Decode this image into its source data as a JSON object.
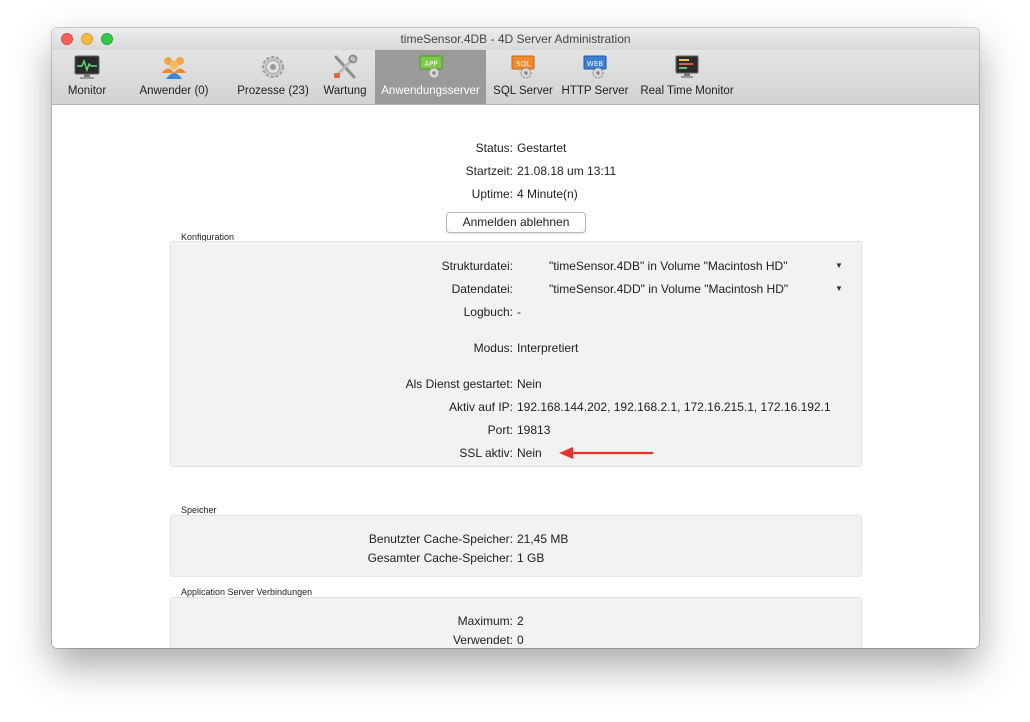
{
  "window": {
    "title": "timeSensor.4DB - 4D Server Administration"
  },
  "toolbar": {
    "items": [
      {
        "label": "Monitor",
        "icon": "monitor-icon"
      },
      {
        "label": "Anwender (0)",
        "icon": "users-icon"
      },
      {
        "label": "Prozesse (23)",
        "icon": "gear-icon"
      },
      {
        "label": "Wartung",
        "icon": "tools-icon"
      },
      {
        "label": "Anwendungsserver",
        "icon": "app-server-icon",
        "active": true
      },
      {
        "label": "SQL Server",
        "icon": "sql-server-icon"
      },
      {
        "label": "HTTP Server",
        "icon": "web-server-icon"
      },
      {
        "label": "Real Time Monitor",
        "icon": "realtime-monitor-icon"
      }
    ],
    "icon_badges": {
      "app": "APP",
      "sql": "SQL",
      "web": "WEB"
    }
  },
  "status": {
    "status_label": "Status:",
    "status_value": "Gestartet",
    "start_label": "Startzeit:",
    "start_value": "21.08.18 um 13:11",
    "uptime_label": "Uptime:",
    "uptime_value": "4 Minute(n)"
  },
  "reject_button": "Anmelden ablehnen",
  "config": {
    "title": "Konfiguration",
    "struktur_label": "Strukturdatei:",
    "struktur_value": "\"timeSensor.4DB\" in Volume \"Macintosh HD\"",
    "daten_label": "Datendatei:",
    "daten_value": "\"timeSensor.4DD\" in Volume \"Macintosh HD\"",
    "log_label": "Logbuch:",
    "log_value": "-",
    "modus_label": "Modus:",
    "modus_value": "Interpretiert",
    "dienst_label": "Als Dienst gestartet:",
    "dienst_value": "Nein",
    "ip_label": "Aktiv auf IP:",
    "ip_value": "192.168.144.202, 192.168.2.1, 172.16.215.1, 172.16.192.1",
    "port_label": "Port:",
    "port_value": "19813",
    "ssl_label": "SSL aktiv:",
    "ssl_value": "Nein"
  },
  "memory": {
    "title": "Speicher",
    "used_label": "Benutzter Cache-Speicher:",
    "used_value": "21,45 MB",
    "total_label": "Gesamter Cache-Speicher:",
    "total_value": "1 GB"
  },
  "connections": {
    "title": "Application Server Verbindungen",
    "max_label": "Maximum:",
    "max_value": "2",
    "used_label": "Verwendet:",
    "used_value": "0"
  },
  "colors": {
    "accent_arrow": "#e8322a",
    "active_tab": "#9a9a9a"
  }
}
